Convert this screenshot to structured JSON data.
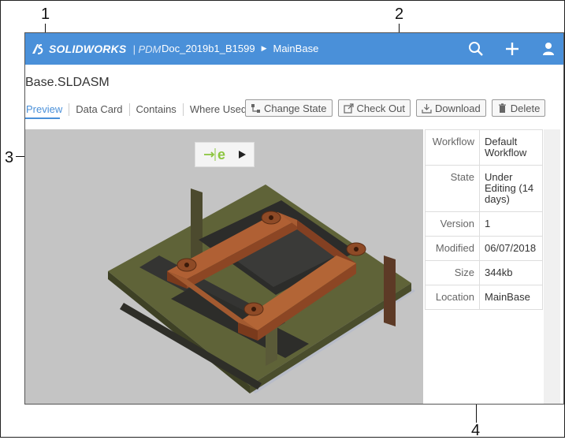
{
  "callouts": [
    "1",
    "2",
    "3",
    "4"
  ],
  "brand": {
    "name": "SOLIDWORKS",
    "product": "PDM",
    "accent": "#4a90d9"
  },
  "breadcrumb": [
    "Doc_2019b1_B1599",
    "MainBase"
  ],
  "topbar_icons": [
    "search-icon",
    "plus-icon",
    "user-icon"
  ],
  "file": {
    "name": "Base.SLDASM"
  },
  "tabs": [
    {
      "label": "Preview",
      "active": true
    },
    {
      "label": "Data Card"
    },
    {
      "label": "Contains"
    },
    {
      "label": "Where Used"
    }
  ],
  "actions": [
    {
      "label": "Change State",
      "icon": "change-state-icon"
    },
    {
      "label": "Check Out",
      "icon": "check-out-icon"
    },
    {
      "label": "Download",
      "icon": "download-icon"
    },
    {
      "label": "Delete",
      "icon": "trash-icon"
    }
  ],
  "viewer_toggle_icons": [
    "edrawings-icon",
    "play-icon"
  ],
  "properties": [
    {
      "key": "Workflow",
      "value": "Default Workflow"
    },
    {
      "key": "State",
      "value": "Under Editing (14 days)"
    },
    {
      "key": "Version",
      "value": "1"
    },
    {
      "key": "Modified",
      "value": "06/07/2018"
    },
    {
      "key": "Size",
      "value": "344kb"
    },
    {
      "key": "Location",
      "value": "MainBase"
    }
  ]
}
